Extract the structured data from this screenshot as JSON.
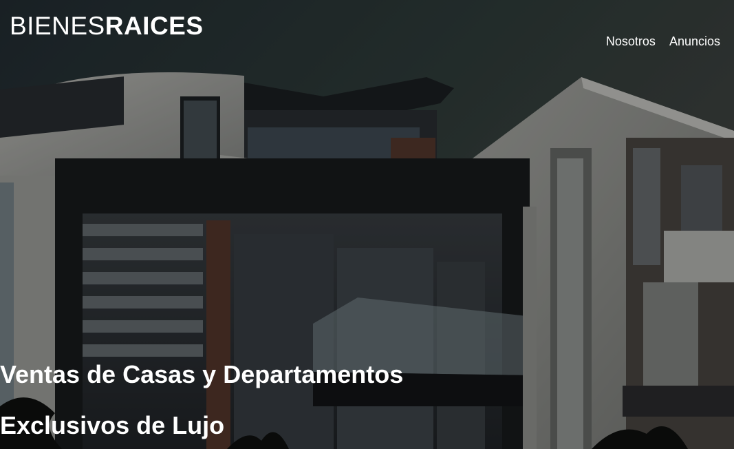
{
  "header": {
    "logo_light": "BIENES",
    "logo_bold": "RAICES",
    "nav": [
      {
        "label": "Nosotros"
      },
      {
        "label": "Anuncios"
      }
    ]
  },
  "hero": {
    "headline_line1": "Ventas de Casas y Departamentos",
    "headline_line2": "Exclusivos de Lujo",
    "image": "modern-house-photo"
  },
  "colors": {
    "text": "#ffffff",
    "sky": "#2f3a3f",
    "overlay": "rgba(0,0,0,0.32)"
  }
}
